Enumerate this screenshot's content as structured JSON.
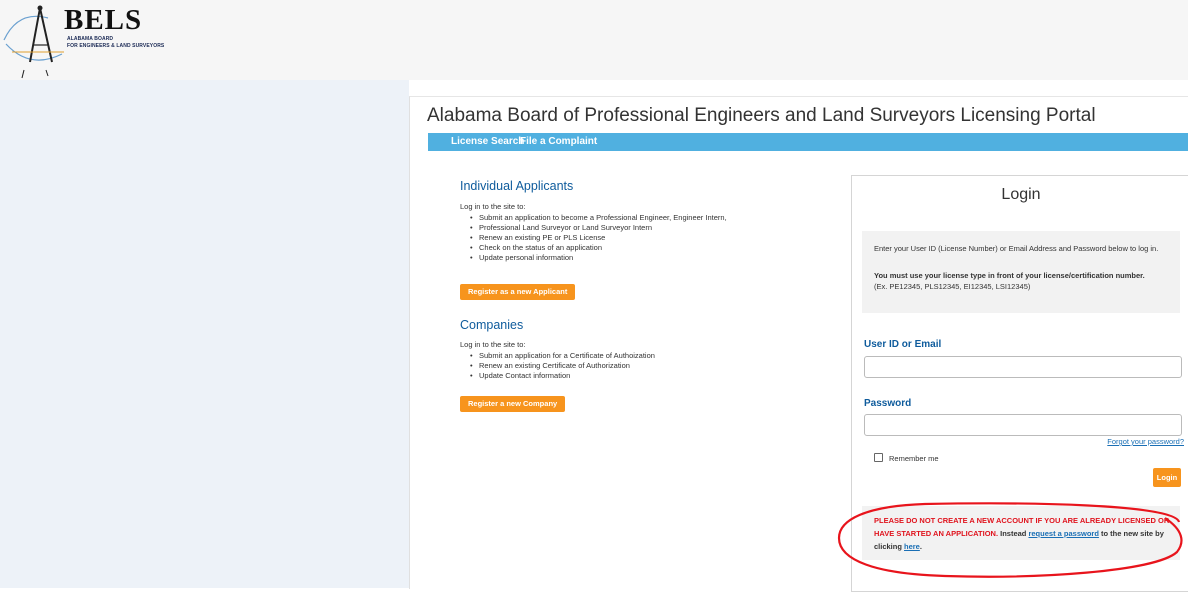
{
  "logo": {
    "title": "BELS",
    "line1": "ALABAMA BOARD",
    "line2": "FOR ENGINEERS & LAND SURVEYORS"
  },
  "portal": {
    "title": "Alabama Board of Professional Engineers and Land Surveyors Licensing Portal",
    "nav": [
      "License Search",
      "File a Complaint"
    ]
  },
  "individual": {
    "title": "Individual Applicants",
    "intro": "Log in to the site to:",
    "items": [
      "Submit an application to become a Professional Engineer, Engineer Intern,",
      "Professional Land Surveyor or Land Surveyor Intern",
      "Renew an existing PE or PLS License",
      "Check on the status of an application",
      "Update personal information"
    ],
    "button": "Register as a new Applicant"
  },
  "companies": {
    "title": "Companies",
    "intro": "Log in to the site to:",
    "items": [
      "Submit an application for a Certificate of Authoization",
      "Renew an existing Certificate of Authorization",
      "Update Contact information"
    ],
    "button": "Register a new Company"
  },
  "login": {
    "title": "Login",
    "info_line1": "Enter your User ID (License Number) or Email Address and Password below to log in.",
    "info_bold": "You must use your license type in front of your license/certification number.",
    "info_example": "(Ex. PE12345, PLS12345, EI12345, LSI12345)",
    "user_label": "User ID or Email",
    "user_value": "",
    "password_label": "Password",
    "password_value": "",
    "forgot": "Forgot your password?",
    "remember": "Remember me",
    "button": "Login"
  },
  "warning": {
    "red_text": "PLEASE DO NOT CREATE A NEW ACCOUNT IF YOU ARE ALREADY LICENSED OR HAVE STARTED AN APPLICATION.",
    "text1": " Instead ",
    "link1": "request a password",
    "text2": " to the new site by clicking ",
    "link2": "here",
    "text3": "."
  },
  "colors": {
    "nav_bar": "#50b0e0",
    "accent_orange": "#f7941d",
    "heading_blue": "#0e5b9c",
    "warning_red": "#e0141e",
    "annotation_circle": "#e8141c"
  }
}
